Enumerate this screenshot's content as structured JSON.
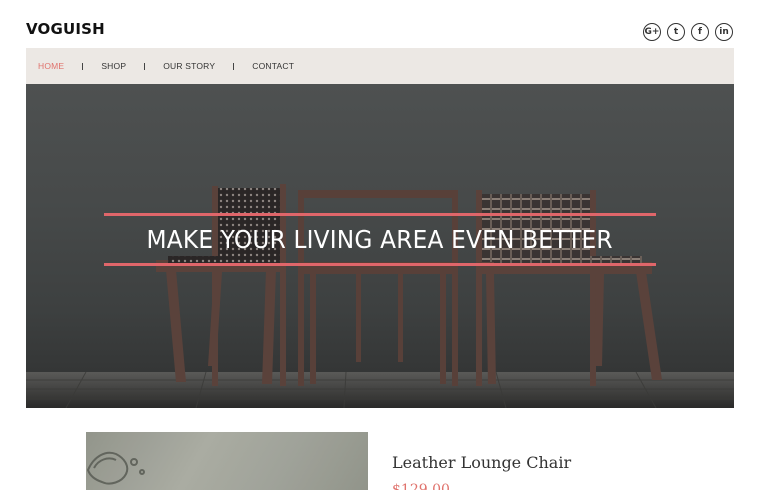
{
  "header": {
    "logo": "VOGUISH",
    "socials": [
      {
        "icon": "google-plus-icon",
        "glyph": "G+"
      },
      {
        "icon": "twitter-icon",
        "glyph": "t"
      },
      {
        "icon": "facebook-icon",
        "glyph": "f"
      },
      {
        "icon": "linkedin-icon",
        "glyph": "in"
      }
    ]
  },
  "nav": {
    "items": [
      {
        "label": "HOME",
        "active": true
      },
      {
        "label": "SHOP",
        "active": false
      },
      {
        "label": "OUR STORY",
        "active": false
      },
      {
        "label": "CONTACT",
        "active": false
      }
    ]
  },
  "hero": {
    "headline": "MAKE YOUR LIVING AREA EVEN BETTER",
    "accent_color": "#e0666a"
  },
  "product": {
    "title": "Leather Lounge Chair",
    "price": "$129.00"
  },
  "colors": {
    "accent": "#e0736d",
    "nav_bg": "#ece8e4"
  }
}
